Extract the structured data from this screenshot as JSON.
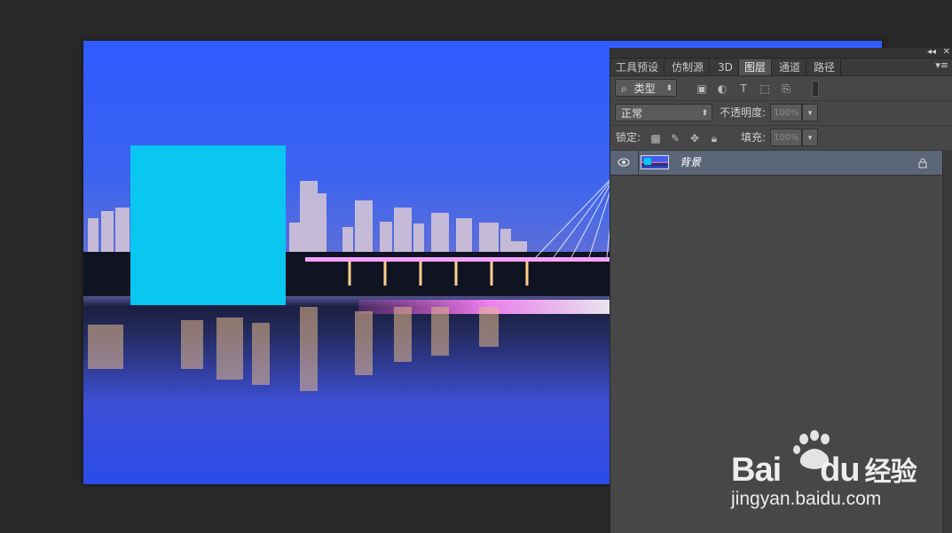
{
  "panel": {
    "tabs": [
      {
        "label": "工具预设",
        "active": false
      },
      {
        "label": "仿制源",
        "active": false
      },
      {
        "label": "3D",
        "active": false
      },
      {
        "label": "图层",
        "active": true
      },
      {
        "label": "通道",
        "active": false
      },
      {
        "label": "路径",
        "active": false
      }
    ],
    "topbar": {
      "collapse": "◂◂",
      "close": "✕"
    },
    "menu_icon": "▾≡",
    "filter": {
      "search_glyph": "⌕",
      "kind_label": "类型"
    },
    "filter_icons": [
      "image-filter-icon",
      "adjustment-filter-icon",
      "type-filter-icon",
      "shape-filter-icon",
      "smart-object-filter-icon"
    ],
    "blend_mode": "正常",
    "opacity_label": "不透明度:",
    "opacity_value": "100%",
    "lock_label": "锁定:",
    "fill_label": "填充:",
    "fill_value": "100%",
    "layers": [
      {
        "name": "背景",
        "visible": true,
        "locked": true
      }
    ]
  },
  "watermark": {
    "brand_latin": "Bai",
    "brand_latin2": "du",
    "brand_cn": "经验",
    "url": "jingyan.baidu.com"
  },
  "colors": {
    "app_background": "#282828",
    "panel_background": "#474747",
    "selected_layer": "#5a6578",
    "cyan_shape": "#0ac7f2",
    "sky_blue": "#2f5bff"
  }
}
